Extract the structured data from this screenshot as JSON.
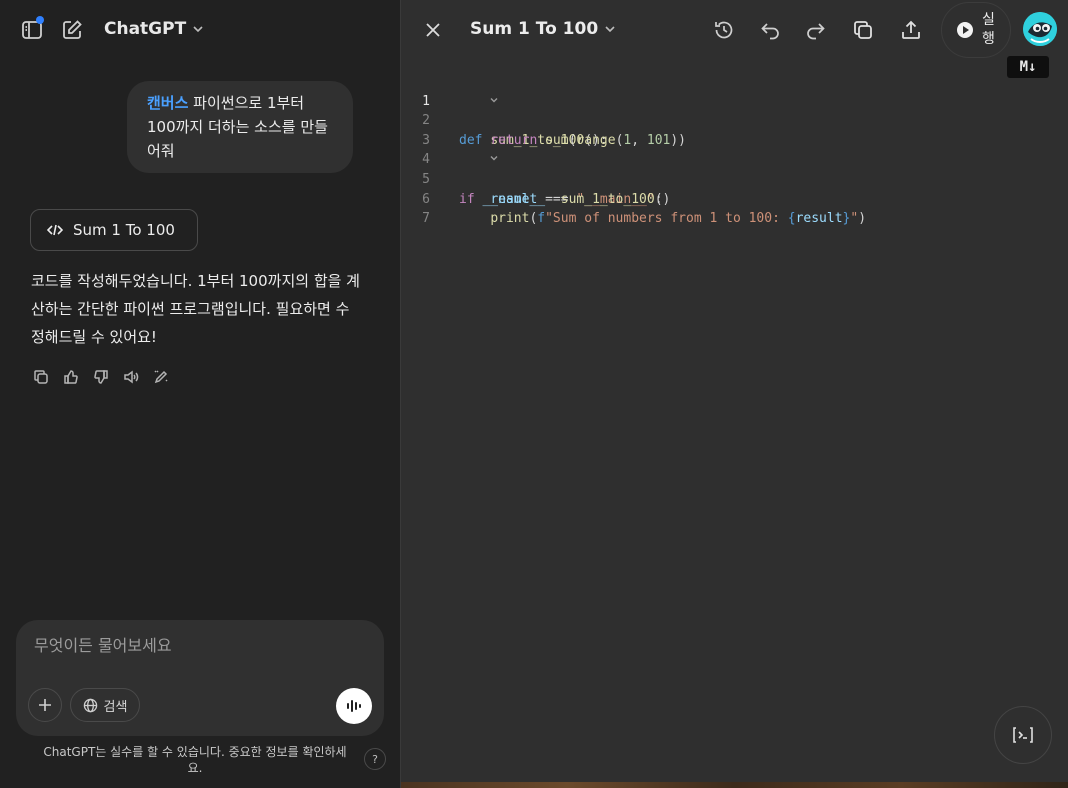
{
  "header": {
    "app_title": "ChatGPT"
  },
  "conversation": {
    "user_tag": "캔버스",
    "user_message": " 파이썬으로  1부터 100까지 더하는 소스를 만들어줘",
    "canvas_chip_label": "Sum 1 To 100",
    "assistant_message": "코드를 작성해두었습니다. 1부터 100까지의 합을 계산하는 간단한 파이썬 프로그램입니다. 필요하면 수정해드릴 수 있어요!",
    "actions": [
      "copy-icon",
      "thumbs-up-icon",
      "thumbs-down-icon",
      "read-aloud-icon",
      "edit-in-canvas-icon"
    ]
  },
  "composer": {
    "placeholder": "무엇이든 물어보세요",
    "search_label": "검색",
    "disclaimer": "ChatGPT는 실수를 할 수 있습니다. 중요한 정보를 확인하세요.",
    "help_label": "?"
  },
  "canvas": {
    "title": "Sum 1 To 100",
    "run_label": "실행",
    "md_badge": "M↓",
    "console_label": "[>_]",
    "code": {
      "language": "python",
      "active_line": 1,
      "line_numbers": [
        "1",
        "2",
        "3",
        "4",
        "5",
        "6",
        "7"
      ],
      "lines": [
        "def sum_1_to_100():",
        "    return sum(range(1, 101))",
        "",
        "if __name__ == \"__main__\":",
        "    result = sum_1_to_100()",
        "    print(f\"Sum of numbers from 1 to 100: {result}\")",
        ""
      ]
    }
  },
  "colors": {
    "sidebar_bg": "#212121",
    "canvas_bg": "#2f2f2f",
    "accent": "#4aa0ff",
    "notification_dot": "#2f80ff"
  }
}
